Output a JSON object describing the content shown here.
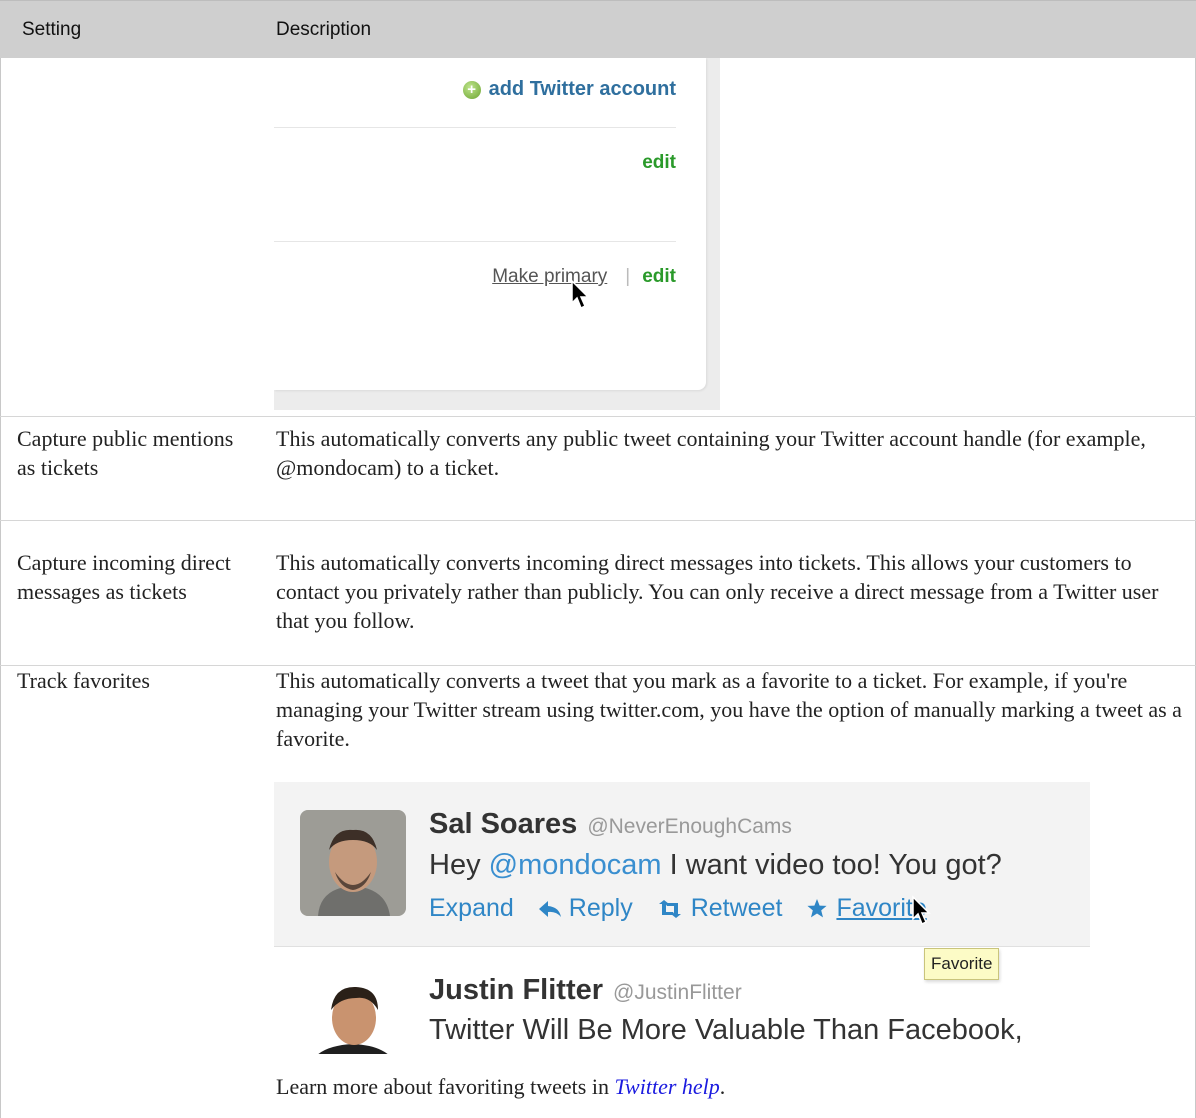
{
  "header": {
    "setting_label": "Setting",
    "description_label": "Description"
  },
  "accounts_panel": {
    "add_account_label": "add Twitter account",
    "add_icon_glyph": "+",
    "edit_label_1": "edit",
    "make_primary_label": "Make primary",
    "separator": "|",
    "edit_label_2": "edit"
  },
  "rows": [
    {
      "setting": "Capture public mentions as tickets",
      "description": "This automatically converts any public tweet containing your Twitter account handle (for example, @mondocam) to a ticket."
    },
    {
      "setting": "Capture incoming direct messages as tickets",
      "description": "This automatically converts incoming direct messages into tickets. This allows your customers to contact you privately rather than publicly. You can only receive a direct message from a Twitter user that you follow."
    },
    {
      "setting": "Track favorites",
      "description": "This automatically converts a tweet that you mark as a favorite to a ticket. For example, if you're managing your Twitter stream using twitter.com, you have the option of manually marking a tweet as a favorite."
    }
  ],
  "tweets": [
    {
      "name": "Sal Soares",
      "handle": "@NeverEnoughCams",
      "text_before": "Hey ",
      "mention": "@mondocam",
      "text_after": " I want video too! You got?",
      "actions": {
        "expand": "Expand",
        "reply": "Reply",
        "retweet": "Retweet",
        "favorite": "Favorite"
      }
    },
    {
      "name": "Justin Flitter",
      "handle": "@JustinFlitter",
      "text": "Twitter Will Be More Valuable Than Facebook,"
    }
  ],
  "tooltip": "Favorite",
  "learn_more": {
    "prefix": "Learn more about favoriting tweets in ",
    "link": "Twitter help",
    "suffix": "."
  },
  "colors": {
    "header_bg": "#cfcfcf",
    "link_blue": "#2f86c6",
    "edit_green": "#2a9a2a",
    "mention_blue": "#3a8fd0"
  },
  "icons": [
    "add-circle-icon",
    "mouse-cursor-icon",
    "reply-arrow-icon",
    "retweet-icon",
    "star-icon"
  ]
}
